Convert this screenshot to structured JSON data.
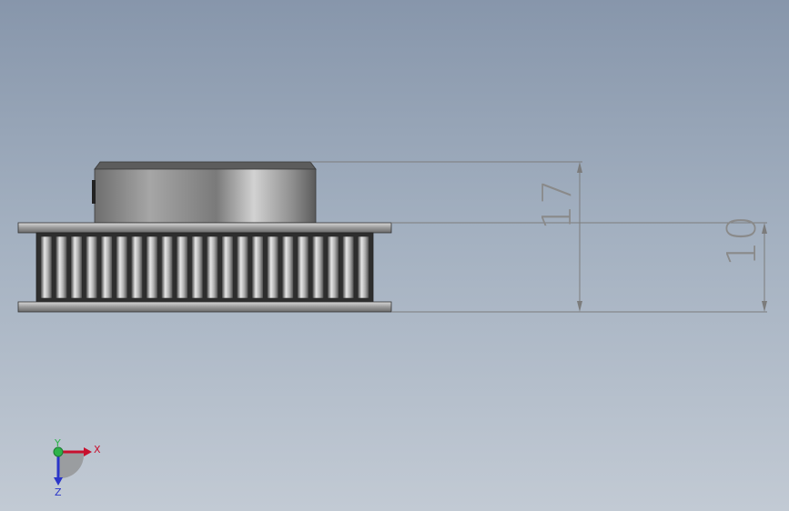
{
  "model": {
    "part": "timing-pulley",
    "tooth_count_visible": 22
  },
  "dimensions": {
    "overall_height": "17",
    "toothed_height": "10"
  },
  "triad": {
    "x_label": "X",
    "y_label": "Y",
    "z_label": "Z",
    "x_color": "#c8102e",
    "y_color": "#2db34a",
    "z_color": "#2a35c9"
  },
  "colors": {
    "dimension_line": "#7c7c7c",
    "background_top": "#8796ab",
    "background_bottom": "#c2cad4"
  }
}
